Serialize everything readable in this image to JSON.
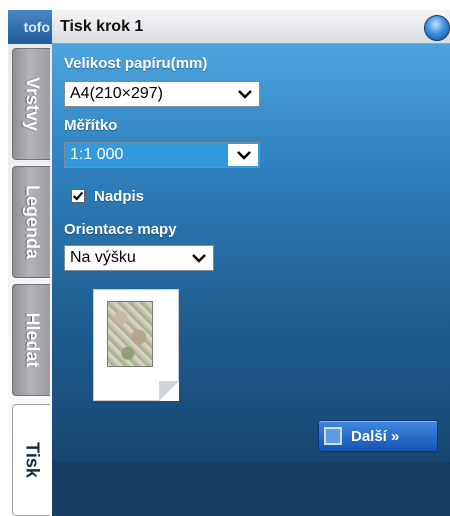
{
  "window": {
    "title": "Tisk krok 1",
    "partial_tab": "tofo"
  },
  "side_tabs": [
    {
      "label": "Vrstvy",
      "active": false
    },
    {
      "label": "Legenda",
      "active": false
    },
    {
      "label": "Hledat",
      "active": false
    },
    {
      "label": "Tisk",
      "active": true
    }
  ],
  "form": {
    "paper_size_label": "Velikost papíru(mm)",
    "paper_size_value": "A4(210×297)",
    "scale_label": "Měřítko",
    "scale_value": "1:1 000",
    "caption_label": "Nadpis",
    "caption_checked": true,
    "orientation_label": "Orientace mapy",
    "orientation_value": "Na výšku"
  },
  "next_button": {
    "label": "Další »"
  },
  "icons": {
    "globe": "globe-icon",
    "dropdown": "chevron-down-icon",
    "check": "checkmark-icon",
    "page": "page-preview-icon"
  },
  "colors": {
    "panel_top": "#4da4dd",
    "panel_bottom": "#18466f",
    "selected_field": "#3399dd",
    "button": "#1653b0"
  }
}
